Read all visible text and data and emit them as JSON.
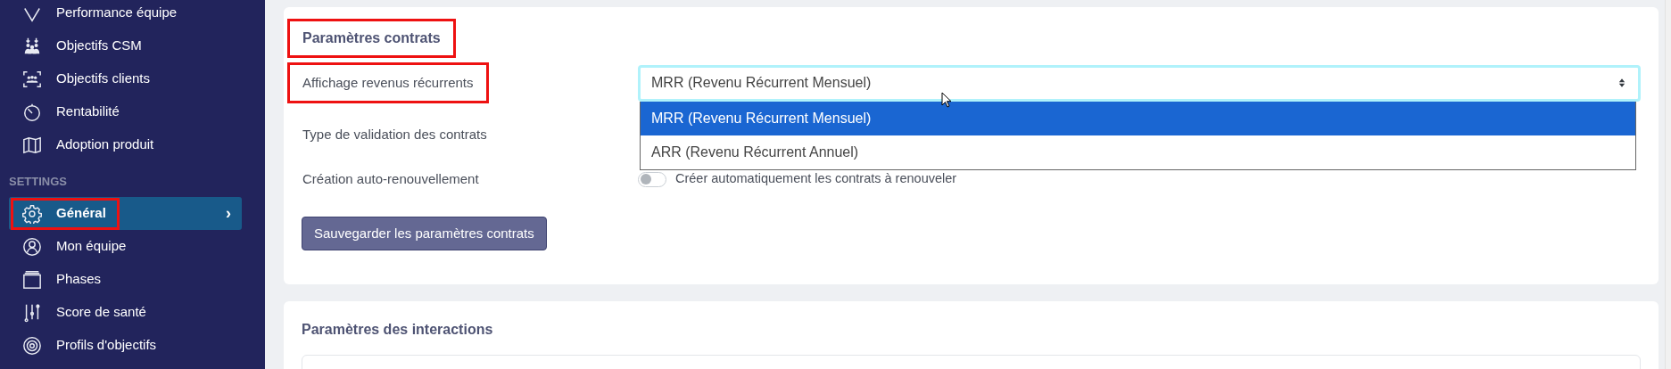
{
  "sidebar": {
    "items": [
      {
        "label": "Performance équipe",
        "selected": false,
        "highlighted": false
      },
      {
        "label": "Objectifs CSM",
        "selected": false,
        "highlighted": false
      },
      {
        "label": "Objectifs clients",
        "selected": false,
        "highlighted": false
      },
      {
        "label": "Rentabilité",
        "selected": false,
        "highlighted": false
      },
      {
        "label": "Adoption produit",
        "selected": false,
        "highlighted": false
      },
      {
        "kind": "section",
        "label": "SETTINGS"
      },
      {
        "label": "Général",
        "selected": true,
        "highlighted": true,
        "chevron": "›"
      },
      {
        "label": "Mon équipe",
        "selected": false,
        "highlighted": false
      },
      {
        "label": "Phases",
        "selected": false,
        "highlighted": false
      },
      {
        "label": "Score de santé",
        "selected": false,
        "highlighted": false
      },
      {
        "label": "Profils d'objectifs",
        "selected": false,
        "highlighted": false
      }
    ]
  },
  "contracts_card": {
    "title": "Paramètres contrats",
    "title_highlighted": true,
    "rows": [
      {
        "kind": "select",
        "label": "Affichage revenus récurrents",
        "highlighted": true,
        "value": "MRR (Revenu Récurrent Mensuel)",
        "expanded": true,
        "options": [
          {
            "label": "MRR (Revenu Récurrent Mensuel)",
            "selected": true
          },
          {
            "label": "ARR (Revenu Récurrent Annuel)",
            "selected": false
          }
        ]
      },
      {
        "kind": "empty",
        "label": "Type de validation des contrats",
        "highlighted": false
      },
      {
        "kind": "toggle",
        "label": "Création auto-renouvellement",
        "highlighted": false,
        "on": false,
        "text": "Créer automatiquement les contrats à renouveler"
      }
    ],
    "button": "Sauvegarder les paramètres contrats"
  },
  "interactions_card": {
    "title": "Paramètres des interactions"
  }
}
